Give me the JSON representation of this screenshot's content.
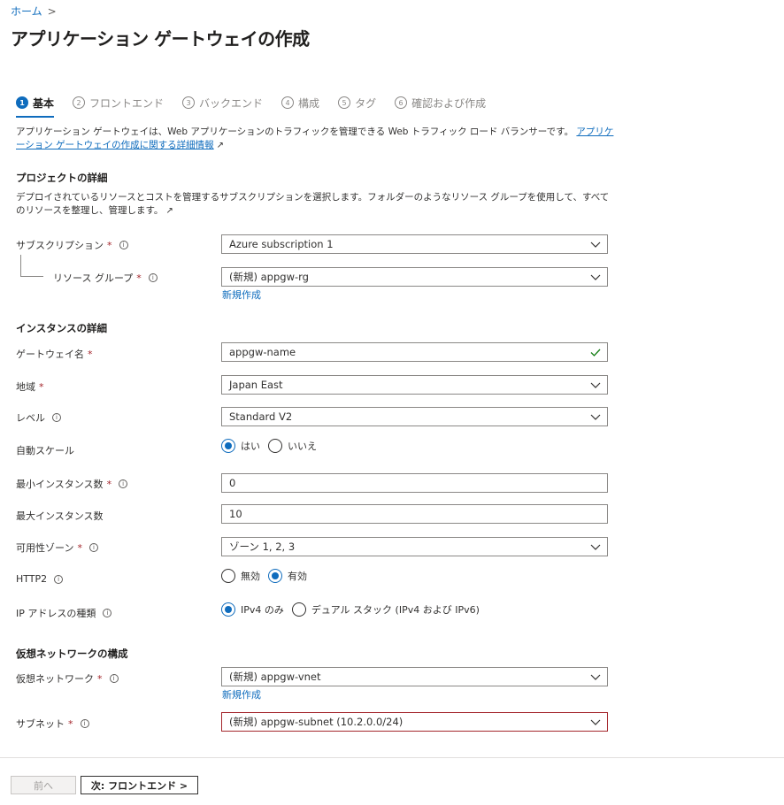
{
  "breadcrumb": {
    "home": "ホーム",
    "sep": ">"
  },
  "header": {
    "title": "アプリケーション ゲートウェイの作成",
    "more": "···"
  },
  "steps": [
    {
      "num": "1",
      "label": "基本"
    },
    {
      "num": "2",
      "label": "フロントエンド"
    },
    {
      "num": "3",
      "label": "バックエンド"
    },
    {
      "num": "4",
      "label": "構成"
    },
    {
      "num": "5",
      "label": "タグ"
    },
    {
      "num": "6",
      "label": "確認および作成"
    }
  ],
  "intro": {
    "text": "アプリケーション ゲートウェイは、Web アプリケーションのトラフィックを管理できる Web トラフィック ロード バランサーです。",
    "link": "アプリケーション ゲートウェイの作成に関する詳細情報"
  },
  "project": {
    "heading": "プロジェクトの詳細",
    "desc": "デプロイされているリソースとコストを管理するサブスクリプションを選択します。フォルダーのようなリソース グループを使用して、すべてのリソースを整理し、管理します。",
    "subscription_label": "サブスクリプション",
    "subscription_value": "Azure subscription 1",
    "rg_label": "リソース グループ",
    "rg_value": "(新規) appgw-rg",
    "rg_create": "新規作成"
  },
  "instance": {
    "heading": "インスタンスの詳細",
    "gateway_name_label": "ゲートウェイ名",
    "gateway_name_value": "appgw-name",
    "region_label": "地域",
    "region_value": "Japan East",
    "tier_label": "レベル",
    "tier_value": "Standard V2",
    "autoscale_label": "自動スケール",
    "autoscale_yes": "はい",
    "autoscale_no": "いいえ",
    "min_label": "最小インスタンス数",
    "min_value": "0",
    "max_label": "最大インスタンス数",
    "max_value": "10",
    "zone_label": "可用性ゾーン",
    "zone_value": "ゾーン 1, 2, 3",
    "http2_label": "HTTP2",
    "http2_off": "無効",
    "http2_on": "有効",
    "ip_label": "IP アドレスの種類",
    "ip_v4": "IPv4 のみ",
    "ip_dual": "デュアル スタック (IPv4 および IPv6)"
  },
  "network": {
    "heading": "仮想ネットワークの構成",
    "vnet_label": "仮想ネットワーク",
    "vnet_value": "(新規) appgw-vnet",
    "vnet_create": "新規作成",
    "subnet_label": "サブネット",
    "subnet_value": "(新規) appgw-subnet (10.2.0.0/24)"
  },
  "footer": {
    "prev": "前へ",
    "next": "次: フロントエンド >"
  },
  "colors": {
    "accent": "#0f6cbd",
    "required": "#a4262c",
    "valid": "#107c10",
    "error_border": "#a4262c"
  },
  "icons": {
    "info": "info-icon",
    "external": "external-link-icon",
    "chevron": "chevron-down-icon",
    "check": "checkmark-icon"
  }
}
